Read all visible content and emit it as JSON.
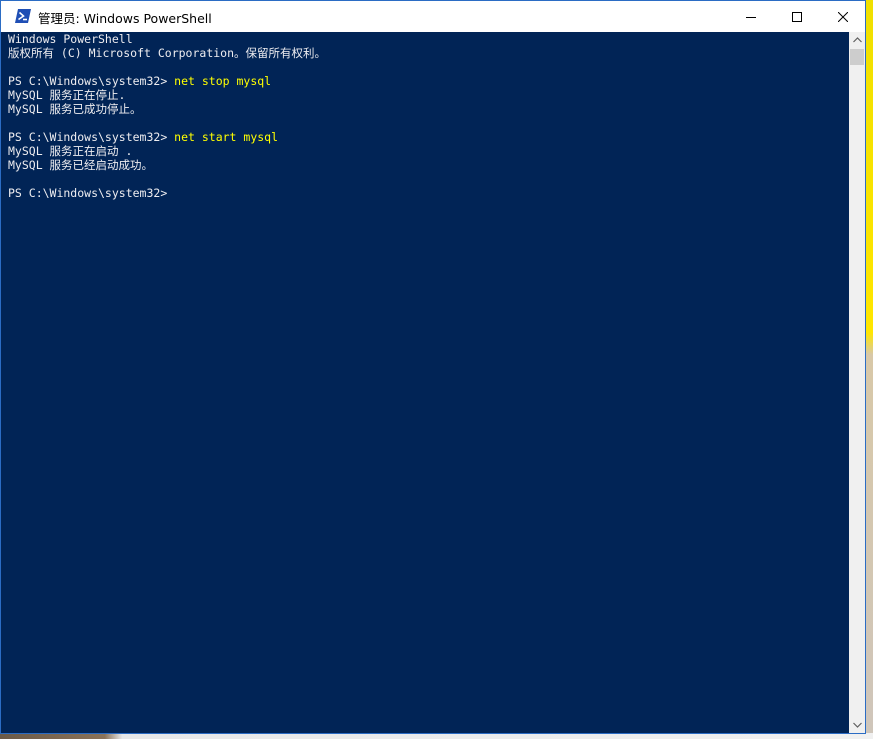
{
  "window": {
    "title": "管理员: Windows PowerShell",
    "icon": "powershell-icon"
  },
  "titlebar_buttons": {
    "minimize": "minimize-icon",
    "maximize": "maximize-icon",
    "close": "close-icon"
  },
  "console": {
    "background": "#012456",
    "text_color": "#eeedf0",
    "command_color": "#ffff00",
    "lines": [
      {
        "text": "Windows PowerShell"
      },
      {
        "text": "版权所有 (C) Microsoft Corporation。保留所有权利。"
      },
      {
        "text": ""
      },
      {
        "prompt": "PS C:\\Windows\\system32> ",
        "command": "net stop mysql"
      },
      {
        "text": "MySQL 服务正在停止."
      },
      {
        "text": "MySQL 服务已成功停止。"
      },
      {
        "text": ""
      },
      {
        "prompt": "PS C:\\Windows\\system32> ",
        "command": "net start mysql"
      },
      {
        "text": "MySQL 服务正在启动 ."
      },
      {
        "text": "MySQL 服务已经启动成功。"
      },
      {
        "text": ""
      },
      {
        "prompt": "PS C:\\Windows\\system32>",
        "command": ""
      }
    ]
  },
  "scrollbar": {
    "up": "scroll-up-arrow-icon",
    "down": "scroll-down-arrow-icon"
  }
}
